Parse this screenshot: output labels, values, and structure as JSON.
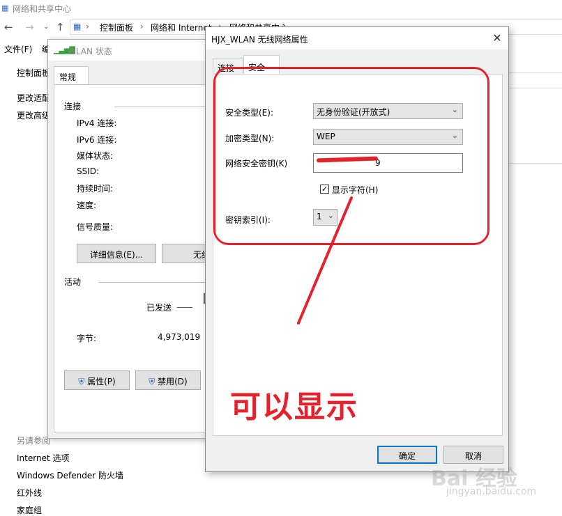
{
  "explorer": {
    "title": "网络和共享中心",
    "address_parts": [
      "控制面板",
      "网络和 Internet",
      "网络和共享中心"
    ],
    "menu_file": "文件(F)",
    "menu_edit_fragment": "编",
    "side_home_fragment": "控制面板",
    "side_link1_fragment": "更改适配",
    "side_link2_fragment": "更改高级",
    "see_also": "另请参阅",
    "links": [
      "Internet 选项",
      "Windows Defender 防火墙",
      "红外线",
      "家庭组"
    ]
  },
  "wlan": {
    "title": "WLAN 状态",
    "tab": "常规",
    "connection_group": "连接",
    "fields": [
      "IPv4 连接:",
      "IPv6 连接:",
      "媒体状态:",
      "SSID:",
      "持续时间:",
      "速度:",
      "信号质量:"
    ],
    "details_button": "详细信息(E)...",
    "wireless_button_fragment": "无线",
    "activity_group": "活动",
    "sent_label": "已发送",
    "bytes_label": "字节:",
    "bytes_sent": "4,973,019",
    "properties_button": "属性(P)",
    "disable_button": "禁用(D)"
  },
  "dialog": {
    "title": "HJX_WLAN 无线网络属性",
    "tabs": [
      "连接",
      "安全"
    ],
    "security_type_label": "安全类型(E):",
    "security_type_value": "无身份验证(开放式)",
    "encryption_type_label": "加密类型(N):",
    "encryption_type_value": "WEP",
    "key_label": "网络安全密钥(K)",
    "key_value_tail": "9",
    "show_chars_label": "显示字符(H)",
    "show_chars_checked": "✓",
    "key_index_label": "密钥索引(I):",
    "key_index_value": "1",
    "ok_button": "确定",
    "cancel_button": "取消"
  },
  "annotation": {
    "caption": "可以显示",
    "color": "#e4222c"
  },
  "watermark": {
    "text": "Bai 经验",
    "sub": "jingyan.baidu.com"
  }
}
